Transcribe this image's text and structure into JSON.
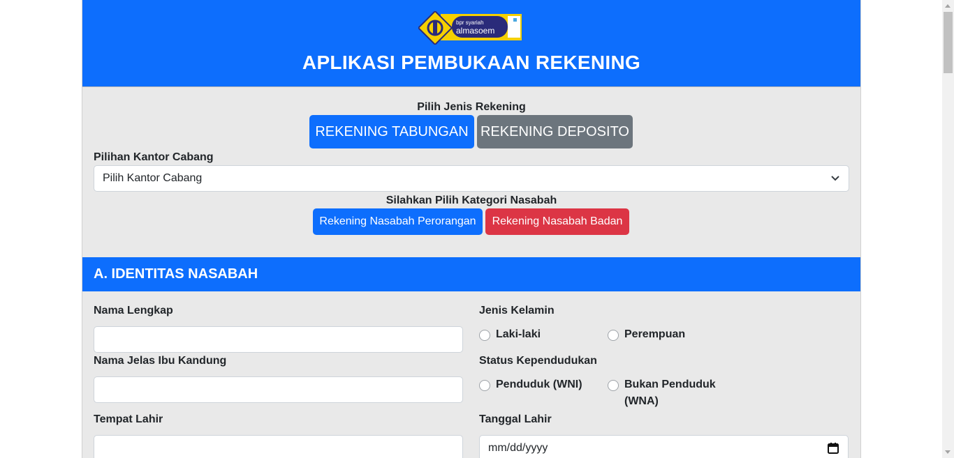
{
  "header": {
    "logo_text_small": "bpr syariah",
    "logo_text_main": "almasoem",
    "title": "APLIKASI PEMBUKAAN REKENING"
  },
  "account_type": {
    "label": "Pilih Jenis Rekening",
    "tabungan_label": "REKENING TABUNGAN",
    "deposito_label": "REKENING DEPOSITO"
  },
  "branch": {
    "label": "Pilihan Kantor Cabang",
    "selected": "Pilih Kantor Cabang"
  },
  "customer_category": {
    "label": "Silahkan Pilih Kategori Nasabah",
    "perorangan_label": "Rekening Nasabah Perorangan",
    "badan_label": "Rekening Nasabah Badan"
  },
  "section_a": {
    "title": "A. IDENTITAS NASABAH",
    "nama_lengkap_label": "Nama Lengkap",
    "nama_lengkap_value": "",
    "nama_ibu_label": "Nama Jelas Ibu Kandung",
    "nama_ibu_value": "",
    "tempat_lahir_label": "Tempat Lahir",
    "tempat_lahir_value": "",
    "jenis_kelamin_label": "Jenis Kelamin",
    "laki_label": "Laki-laki",
    "perempuan_label": "Perempuan",
    "status_label": "Status Kependudukan",
    "wni_label": "Penduduk (WNI)",
    "wna_label_1": "Bukan Penduduk",
    "wna_label_2": "(WNA)",
    "tanggal_lahir_label": "Tanggal Lahir",
    "tanggal_lahir_placeholder": "mm/dd/yyyy"
  },
  "colors": {
    "primary": "#0d6efd",
    "secondary": "#6c757d",
    "danger": "#dc3545",
    "logo_yellow": "#f5d000",
    "logo_navy": "#2a2b7a"
  }
}
